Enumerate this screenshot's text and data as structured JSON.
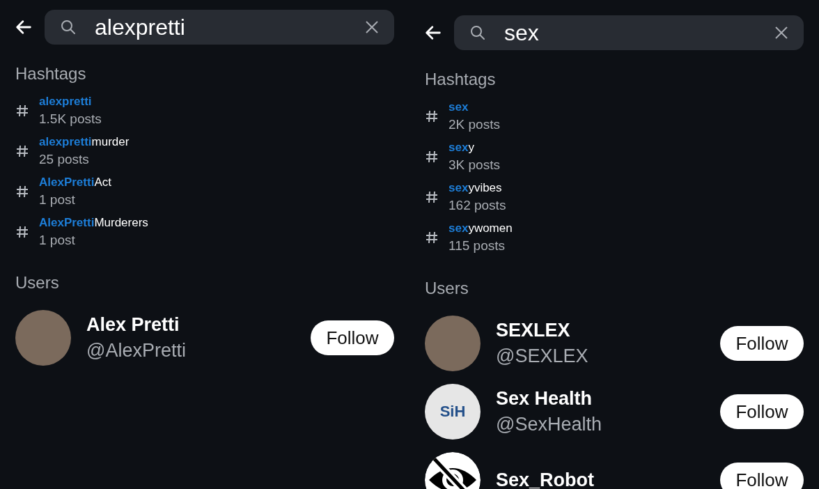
{
  "panels": [
    {
      "search": {
        "value": "alexpretti"
      },
      "hashtags_heading": "Hashtags",
      "hashtags": [
        {
          "match": "alexpretti",
          "count": "1.5K posts"
        },
        {
          "match": "alexpretti",
          "rest": "murder",
          "count": "25 posts"
        },
        {
          "match": "AlexPretti",
          "rest": "Act",
          "count": "1 post"
        },
        {
          "match": "AlexPretti",
          "rest": "Murderers",
          "count": "1 post"
        }
      ],
      "users_heading": "Users",
      "users": [
        {
          "name": "Alex Pretti",
          "handle": "@AlexPretti",
          "avatar": {
            "kind": "photo"
          },
          "button": "Follow"
        }
      ]
    },
    {
      "search": {
        "value": "sex"
      },
      "hashtags_heading": "Hashtags",
      "hashtags": [
        {
          "match": "sex",
          "count": "2K posts"
        },
        {
          "match": "sex",
          "rest": "y",
          "count": "3K posts"
        },
        {
          "match": "sex",
          "rest": "yvibes",
          "count": "162 posts"
        },
        {
          "match": "sex",
          "rest": "ywomen",
          "count": "115 posts"
        }
      ],
      "users_heading": "Users",
      "users": [
        {
          "name": "SEXLEX",
          "handle": "@SEXLEX",
          "avatar": {
            "kind": "photo"
          },
          "button": "Follow"
        },
        {
          "name": "Sex Health",
          "handle": "@SexHealth",
          "avatar": {
            "kind": "logo",
            "text": "SiH"
          },
          "button": "Follow"
        },
        {
          "name": "Sex_Robot",
          "avatar": {
            "kind": "hidden"
          },
          "button": "Follow"
        }
      ]
    }
  ]
}
